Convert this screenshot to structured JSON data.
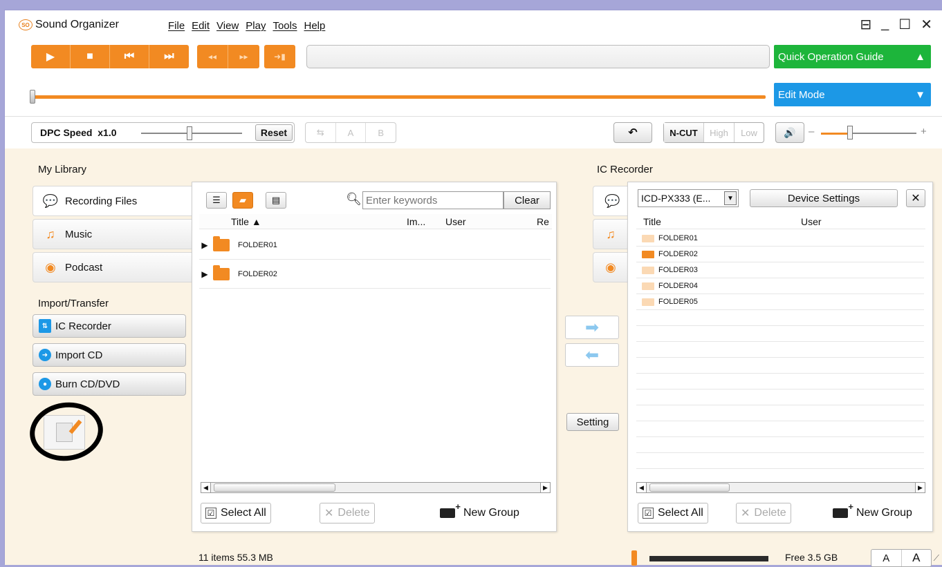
{
  "app": {
    "title": "Sound Organizer",
    "logo_text": "SO",
    "menu": [
      "File",
      "Edit",
      "View",
      "Play",
      "Tools",
      "Help"
    ],
    "window_controls": [
      "⊟",
      "_",
      "☐",
      "✕"
    ]
  },
  "toolbar": {
    "quick_guide_label": "Quick Operation Guide",
    "edit_mode_label": "Edit Mode",
    "dpc_label": "DPC Speed  x1.0",
    "reset_label": "Reset",
    "ab_labels": [
      "⇆",
      "A",
      "B"
    ],
    "ncut_label": "N-CUT",
    "high_label": "High",
    "low_label": "Low",
    "vol_minus": "–",
    "vol_plus": "+"
  },
  "library": {
    "title": "My Library",
    "tabs": [
      {
        "label": "Recording Files",
        "icon": "speech-bubble-icon"
      },
      {
        "label": "Music",
        "icon": "music-note-icon"
      },
      {
        "label": "Podcast",
        "icon": "podcast-icon"
      }
    ],
    "import_title": "Import/Transfer",
    "import_buttons": [
      {
        "label": "IC Recorder",
        "icon": "ic-recorder-icon"
      },
      {
        "label": "Import CD",
        "icon": "import-cd-icon"
      },
      {
        "label": "Burn CD/DVD",
        "icon": "burn-cd-icon"
      }
    ]
  },
  "file_panel": {
    "search_placeholder": "Enter keywords",
    "clear_label": "Clear",
    "columns": [
      "Title ▲",
      "Im...",
      "User",
      "Re"
    ],
    "folders": [
      "FOLDER01",
      "FOLDER02"
    ],
    "select_all_label": "Select All",
    "delete_label": "Delete",
    "new_group_label": "New Group",
    "status": "11 items 55.3 MB"
  },
  "transfer": {
    "setting_label": "Setting"
  },
  "ic_recorder": {
    "title": "IC Recorder",
    "device": "ICD-PX333 (E...",
    "device_settings_label": "Device Settings",
    "close_label": "✕",
    "columns": [
      "Title",
      "User"
    ],
    "folders": [
      {
        "name": "FOLDER01",
        "color": "#fbd9b4"
      },
      {
        "name": "FOLDER02",
        "color": "#f28a22"
      },
      {
        "name": "FOLDER03",
        "color": "#fbd9b4"
      },
      {
        "name": "FOLDER04",
        "color": "#fbd9b4"
      },
      {
        "name": "FOLDER05",
        "color": "#fbd9b4"
      }
    ],
    "select_all_label": "Select All",
    "delete_label": "Delete",
    "new_group_label": "New Group",
    "free_label": "Free 3.5 GB",
    "font_small": "A",
    "font_large": "A"
  }
}
